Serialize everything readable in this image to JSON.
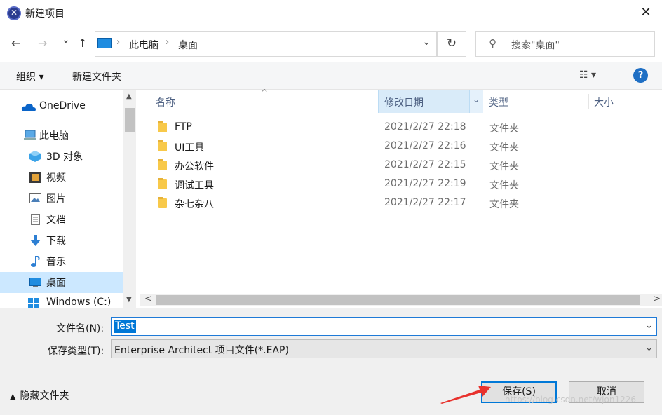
{
  "window": {
    "title": "新建项目",
    "close_label": "✕"
  },
  "nav": {
    "back": "←",
    "forward": "→",
    "recent": "⌄",
    "up": "↑",
    "breadcrumb_sep": "›",
    "breadcrumbs": [
      "此电脑",
      "桌面"
    ],
    "address_dropdown": "⌄",
    "refresh": "↻",
    "search_icon": "⚲",
    "search_placeholder": "搜索\"桌面\""
  },
  "toolbar": {
    "organize": "组织 ▾",
    "new_folder": "新建文件夹",
    "view": "☷ ▾",
    "help": "?"
  },
  "sidebar": {
    "items": [
      {
        "label": "OneDrive",
        "icon": "cloud-icon"
      },
      {
        "label": "此电脑",
        "icon": "computer-icon"
      },
      {
        "label": "3D 对象",
        "icon": "cube-icon"
      },
      {
        "label": "视频",
        "icon": "film-icon"
      },
      {
        "label": "图片",
        "icon": "picture-icon"
      },
      {
        "label": "文档",
        "icon": "document-icon"
      },
      {
        "label": "下载",
        "icon": "download-icon"
      },
      {
        "label": "音乐",
        "icon": "music-icon"
      },
      {
        "label": "桌面",
        "icon": "desktop-icon"
      },
      {
        "label": "Windows (C:)",
        "icon": "drive-icon"
      }
    ],
    "scroll_up": "▲",
    "scroll_down": "▼"
  },
  "columns": {
    "name": "名称",
    "modified": "修改日期",
    "type": "类型",
    "size": "大小",
    "sort_caret": "^",
    "col_dropdown": "⌄"
  },
  "files": [
    {
      "name": "FTP",
      "modified": "2021/2/27 22:18",
      "type": "文件夹"
    },
    {
      "name": "UI工具",
      "modified": "2021/2/27 22:16",
      "type": "文件夹"
    },
    {
      "name": "办公软件",
      "modified": "2021/2/27 22:15",
      "type": "文件夹"
    },
    {
      "name": "调试工具",
      "modified": "2021/2/27 22:19",
      "type": "文件夹"
    },
    {
      "name": "杂七杂八",
      "modified": "2021/2/27 22:17",
      "type": "文件夹"
    }
  ],
  "hscroll": {
    "left": "<",
    "right": ">"
  },
  "form": {
    "filename_label": "文件名(N):",
    "filename_value": "Test",
    "filetype_label": "保存类型(T):",
    "filetype_value": "Enterprise Architect 项目文件(*.EAP)",
    "dropdown": "⌄",
    "hide_folders": "隐藏文件夹",
    "save": "保存(S)",
    "cancel": "取消"
  },
  "watermark": "https://blog.csdn.net/wjon1226",
  "colors": {
    "accent": "#0078d7",
    "selection": "#cce8ff",
    "arrow": "#e8322d"
  }
}
